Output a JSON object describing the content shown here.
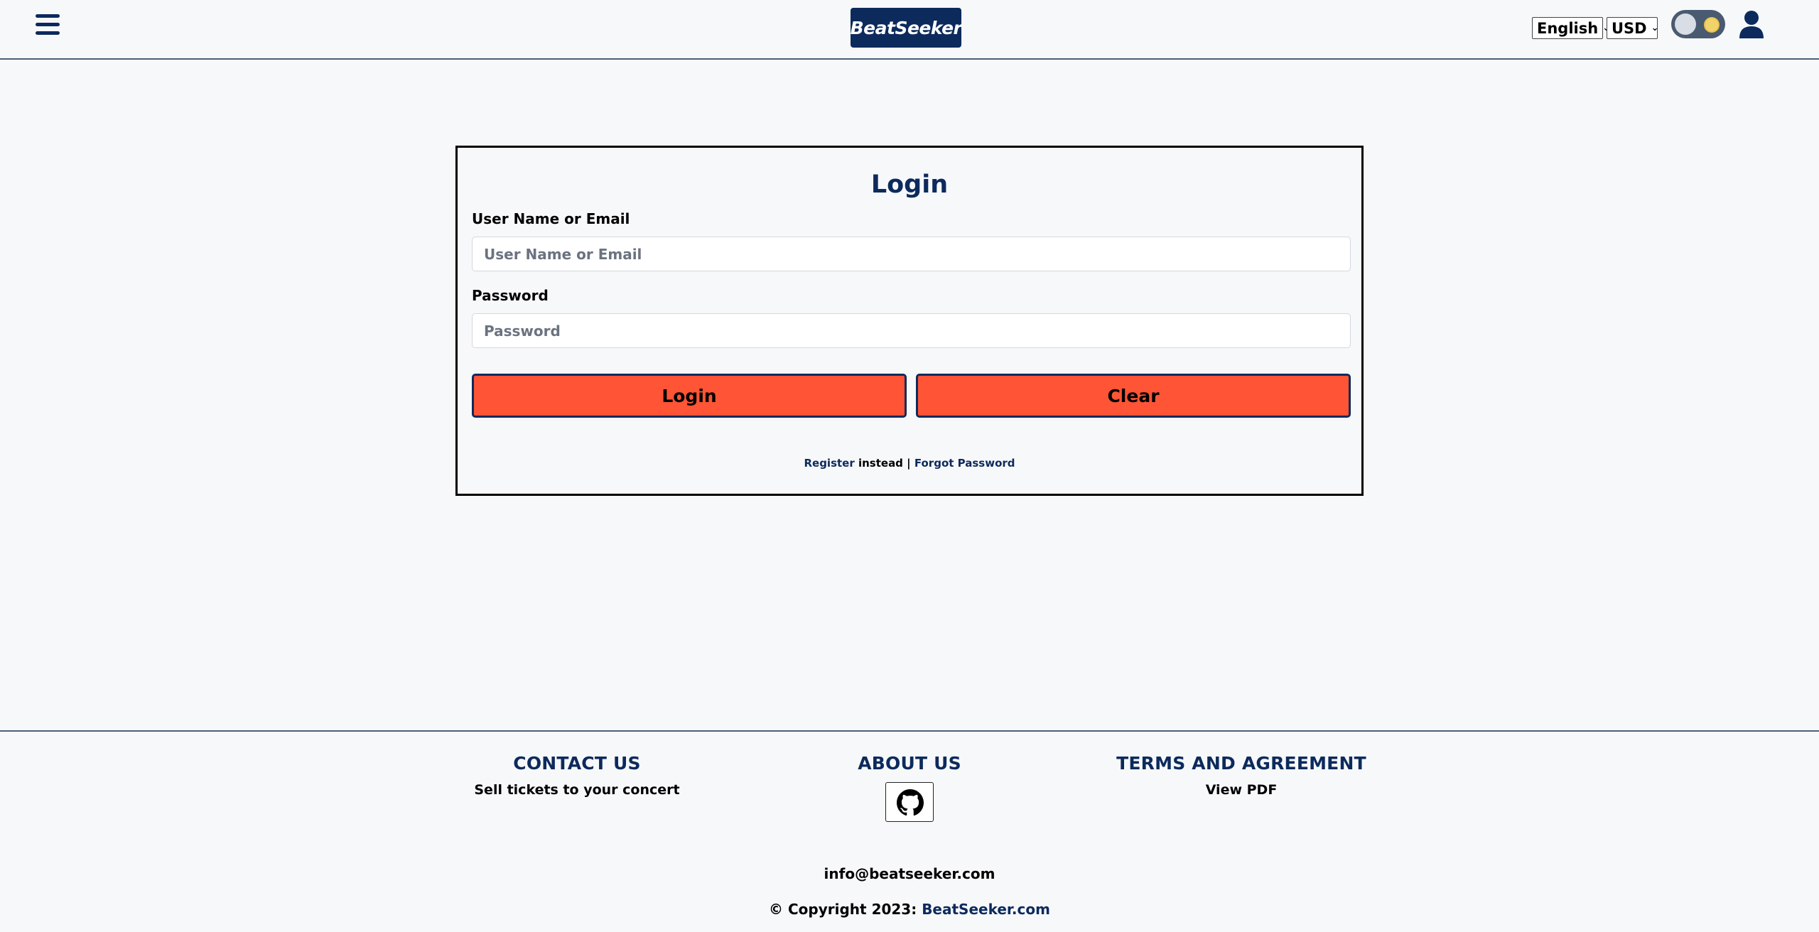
{
  "header": {
    "menu_icon": "hamburger-menu-icon",
    "logo": "BeatSeeker",
    "language": "English",
    "currency": "USD",
    "theme_toggle_icon": "sun-moon-toggle-icon",
    "user_icon": "user-icon"
  },
  "login": {
    "title": "Login",
    "username_label": "User Name or Email",
    "username_placeholder": "User Name or Email",
    "username_value": "",
    "password_label": "Password",
    "password_placeholder": "Password",
    "password_value": "",
    "login_button": "Login",
    "clear_button": "Clear",
    "register_link": "Register",
    "instead_text": " instead | ",
    "forgot_link": "Forgot Password"
  },
  "footer": {
    "contact_title": "CONTACT US",
    "contact_sub": "Sell tickets to your concert",
    "about_title": "ABOUT US",
    "about_icon": "github-icon",
    "terms_title": "TERMS AND AGREEMENT",
    "terms_sub": "View PDF",
    "email": "info@beatseeker.com",
    "copyright_prefix": "© Copyright 2023: ",
    "copyright_link": "BeatSeeker.com"
  },
  "colors": {
    "brand_navy": "#0c2a5c",
    "button_orange": "#ff5435",
    "background": "#f7f8fa"
  }
}
